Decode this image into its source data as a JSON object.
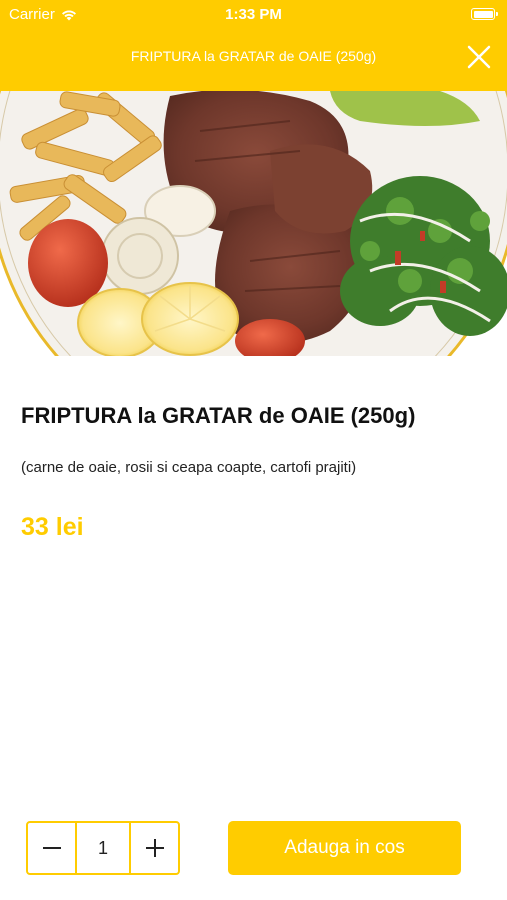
{
  "status_bar": {
    "carrier": "Carrier",
    "time": "1:33 PM"
  },
  "header": {
    "title": "FRIPTURA la GRATAR de OAIE (250g)",
    "close_icon": "close-icon"
  },
  "product": {
    "name": "FRIPTURA la GRATAR de OAIE (250g)",
    "description": "(carne de oaie, rosii si ceapa coapte, cartofi prajiti)",
    "price": "33 lei"
  },
  "cart": {
    "quantity": "1",
    "minus_icon": "minus-icon",
    "plus_icon": "plus-icon",
    "add_label": "Adauga in cos"
  },
  "colors": {
    "accent": "#FFCC00",
    "text": "#111111"
  }
}
